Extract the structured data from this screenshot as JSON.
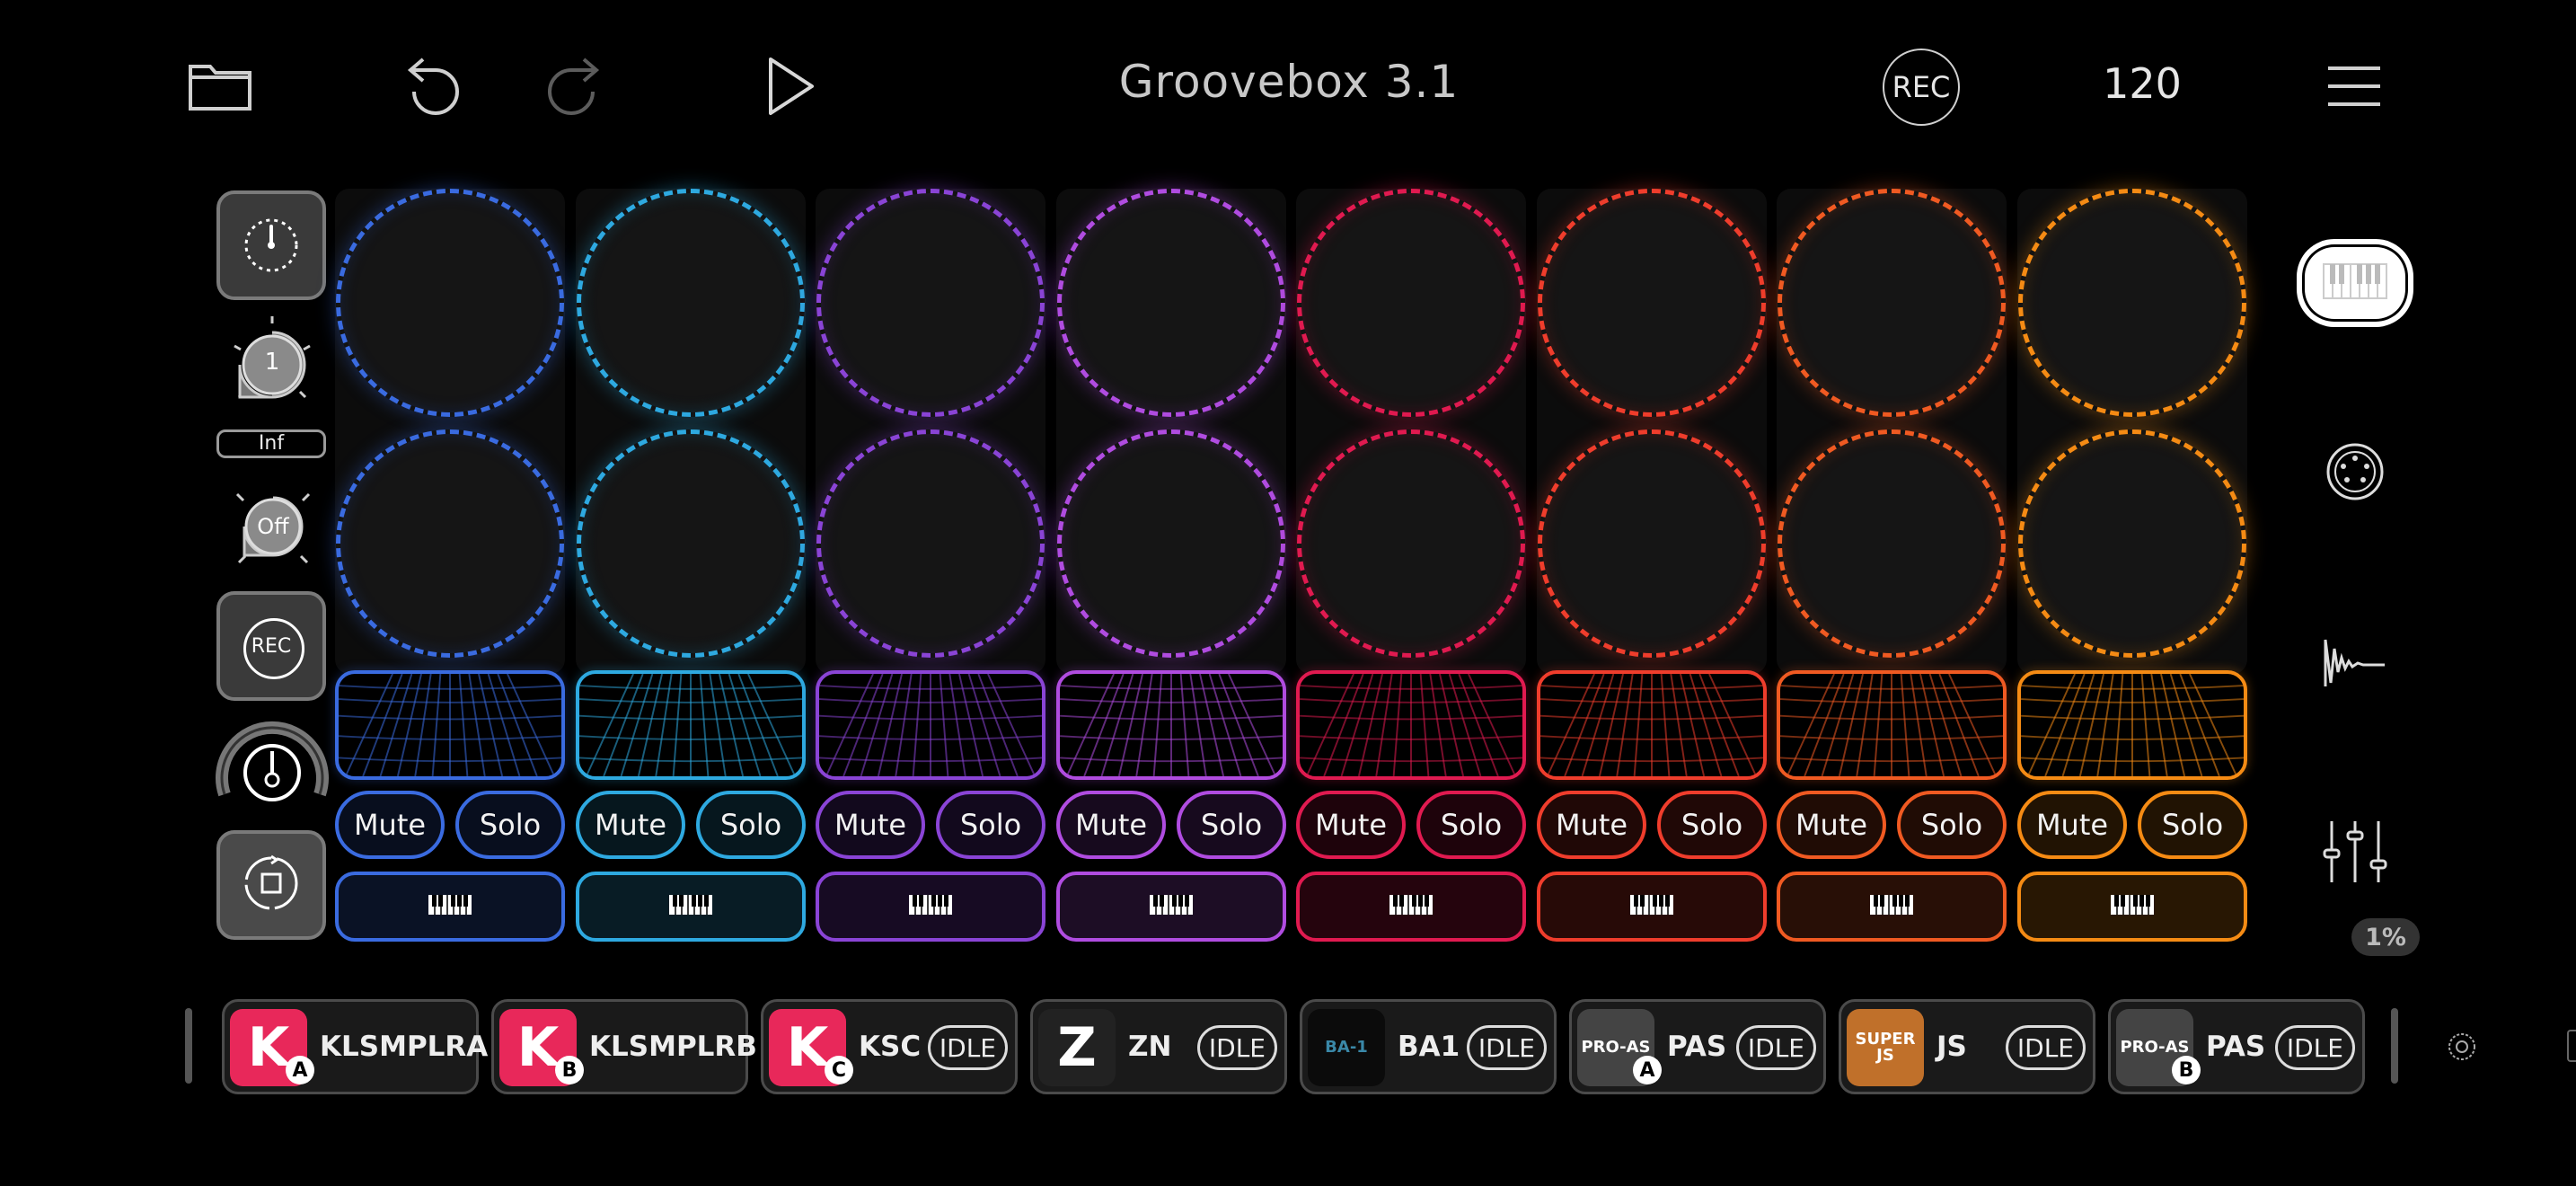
{
  "app": {
    "title": "Groovebox 3.1",
    "tempo": "120",
    "rec_label": "REC"
  },
  "left": {
    "count_knob": "1",
    "loop_label": "Inf",
    "off_knob": "Off",
    "rec_button": "REC"
  },
  "columns": [
    {
      "color": "#3a6be0",
      "mute": "Mute",
      "solo": "Solo"
    },
    {
      "color": "#2ea9e0",
      "mute": "Mute",
      "solo": "Solo"
    },
    {
      "color": "#8a44d6",
      "mute": "Mute",
      "solo": "Solo"
    },
    {
      "color": "#b04ce0",
      "mute": "Mute",
      "solo": "Solo"
    },
    {
      "color": "#e01a50",
      "mute": "Mute",
      "solo": "Solo"
    },
    {
      "color": "#ef3d2c",
      "mute": "Mute",
      "solo": "Solo"
    },
    {
      "color": "#f05a22",
      "mute": "Mute",
      "solo": "Solo"
    },
    {
      "color": "#f58b14",
      "mute": "Mute",
      "solo": "Solo"
    }
  ],
  "sidebar": {
    "cpu": "1%"
  },
  "tracks": [
    {
      "name": "KLSMPLRA",
      "badge": "A",
      "thumb": "K",
      "thumb_color": "#e8285a",
      "status": ""
    },
    {
      "name": "KLSMPLRB",
      "badge": "B",
      "thumb": "K",
      "thumb_color": "#e8285a",
      "status": ""
    },
    {
      "name": "KSC",
      "badge": "C",
      "thumb": "K",
      "thumb_color": "#e8285a",
      "status": "IDLE"
    },
    {
      "name": "ZN",
      "badge": "",
      "thumb": "Z",
      "thumb_color": "#222222",
      "status": "IDLE"
    },
    {
      "name": "BA1",
      "badge": "",
      "thumb": "BA-1",
      "thumb_color": "#0b0b0b",
      "status": "IDLE"
    },
    {
      "name": "PAS",
      "badge": "A",
      "thumb": "PRO-AS",
      "thumb_color": "#444444",
      "status": "IDLE"
    },
    {
      "name": "JS",
      "badge": "",
      "thumb": "SUPER JS",
      "thumb_color": "#c0702a",
      "status": "IDLE"
    },
    {
      "name": "PAS",
      "badge": "B",
      "thumb": "PRO-AS",
      "thumb_color": "#444444",
      "status": "IDLE"
    }
  ]
}
